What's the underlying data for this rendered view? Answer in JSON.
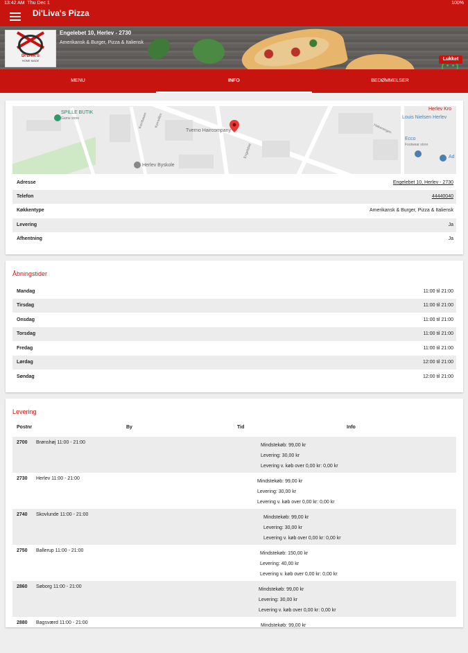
{
  "status": {
    "time": "13:42 AM",
    "date": "Thu Dec 1",
    "battery": "100%"
  },
  "app": {
    "title": "Di'Liva's Pizza"
  },
  "banner": {
    "logo_text": "DI'LIVA'S",
    "logo_subtext": "HOME MADE",
    "address": "Engelebet 10, Herlev - 2730",
    "cuisine": "Amerikansk & Burger, Pizza & Italiensk",
    "status_label": "Lukket"
  },
  "tabs": [
    {
      "label": "MENU"
    },
    {
      "label": "INFO"
    },
    {
      "label": "BEDØMMELSER"
    }
  ],
  "map": {
    "labels": {
      "spille_butik": "SPILLE BUTIK",
      "game_store": "Game store",
      "herlev_kro": "Herlev Kro",
      "louis_nielsen": "Louis Nielsen Herlev",
      "ecco": "Ecco",
      "footwear": "Footwear store",
      "tverno": "Tverno Haircompany",
      "herlev_byskole": "Herlev Byskole",
      "ad": "Ad",
      "street_1": "Kornbaven",
      "street_2": "Kornvillen",
      "street_3": "Engelebet",
      "street_4": "Høkerengen"
    }
  },
  "info": [
    {
      "key": "Adresse",
      "value": "Engelebet 10, Herlev - 2730"
    },
    {
      "key": "Telefon",
      "value": "44440040"
    },
    {
      "key": "Køkkentype",
      "value": "Amerikansk & Burger, Pizza & Italiensk"
    },
    {
      "key": "Levering",
      "value": "Ja"
    },
    {
      "key": "Afhentning",
      "value": "Ja"
    }
  ],
  "hours": {
    "title": "Åbningstider",
    "rows": [
      {
        "day": "Mandag",
        "time": "11:00 til 21:00"
      },
      {
        "day": "Tirsdag",
        "time": "11:00 til 21:00"
      },
      {
        "day": "Onsdag",
        "time": "11:00 til 21:00"
      },
      {
        "day": "Torsdag",
        "time": "11:00 til 21:00"
      },
      {
        "day": "Fredag",
        "time": "11:00 til 21:00"
      },
      {
        "day": "Lørdag",
        "time": "12:00 til 21:00"
      },
      {
        "day": "Søndag",
        "time": "12:00 til 21:00"
      }
    ]
  },
  "delivery": {
    "title": "Levering",
    "headers": {
      "postnr": "Postnr",
      "by": "By",
      "tid": "Tid",
      "info": "Info"
    },
    "rows": [
      {
        "postnr": "2700",
        "town": "Brønshøj   11:00 - 21:00",
        "min": "Mindstekøb: 99,00 kr",
        "fee": "Levering: 30,00 kr",
        "free": "Levering v. køb over 0,00 kr: 0,00 kr"
      },
      {
        "postnr": "2730",
        "town": "Herlev   11:00 - 21:00",
        "min": "Mindstekøb: 99,00 kr",
        "fee": "Levering: 30,00 kr",
        "free": "Levering v. køb over 0,00 kr: 0,00 kr"
      },
      {
        "postnr": "2740",
        "town": "Skovlunde   11:00 - 21:00",
        "min": "Mindstekøb: 99,00 kr",
        "fee": "Levering: 30,00 kr",
        "free": "Levering v. køb over 0,00 kr: 0,00 kr"
      },
      {
        "postnr": "2750",
        "town": "Ballerup   11:00 - 21:00",
        "min": "Mindstekøb: 150,00 kr",
        "fee": "Levering: 40,00 kr",
        "free": "Levering v. køb over 0,00 kr: 0,00 kr"
      },
      {
        "postnr": "2860",
        "town": "Søborg   11:00 - 21:00",
        "min": "Mindstekøb: 99,00 kr",
        "fee": "Levering: 30,00 kr",
        "free": "Levering v. køb over 0,00 kr: 0,00 kr"
      },
      {
        "postnr": "2880",
        "town": "Bagsværd   11:00 - 21:00",
        "min": "Mindstekøb: 99,00 kr",
        "fee": "",
        "free": ""
      }
    ]
  }
}
